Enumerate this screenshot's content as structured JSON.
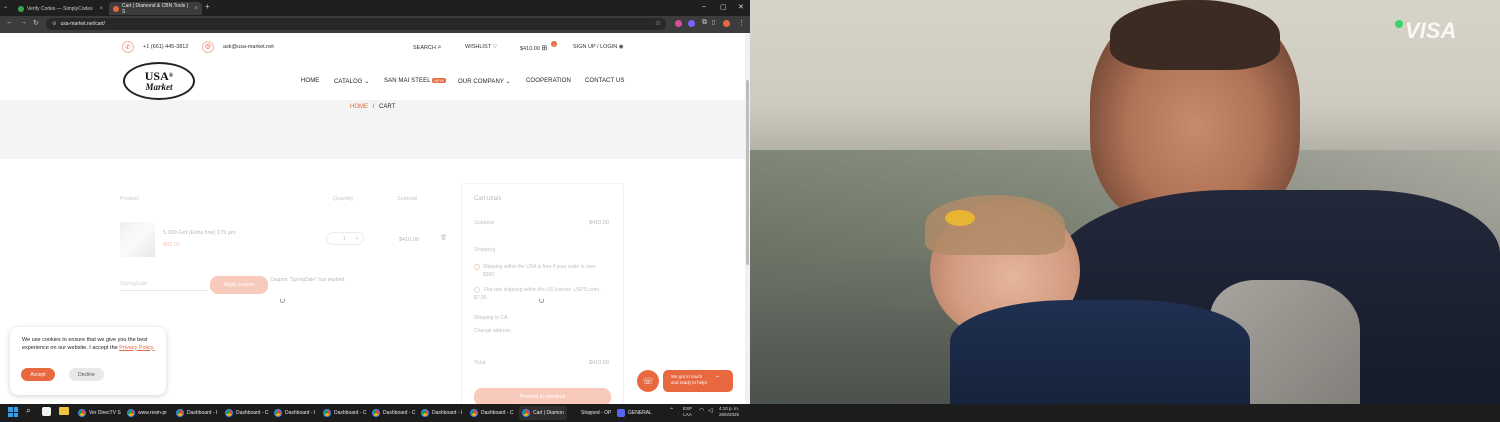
{
  "browser": {
    "tabs": [
      {
        "title": "Verify Codes — SimplyCodes",
        "active": false,
        "color": "#34a853"
      },
      {
        "title": "Cart | Diamond & CBN Tools | S",
        "active": true,
        "color": "#e8683f"
      }
    ],
    "new_tab": "+",
    "url": "usa-market.net/cart/",
    "window_controls": {
      "minimize": "–",
      "maximize": "▢",
      "close": "✕"
    }
  },
  "site": {
    "phone": "+1 (661) 445-3812",
    "email": "ask@usa-market.net",
    "search_label": "SEARCH",
    "wishlist_label": "WISHLIST",
    "cart_total": "$410.00",
    "cart_count": "1",
    "sign_label": "SIGN UP / LOGIN",
    "logo": {
      "top": "USA",
      "reg": "®",
      "bottom": "Market"
    },
    "nav": [
      {
        "label": "HOME"
      },
      {
        "label": "CATALOG",
        "chevron": "⌄"
      },
      {
        "label": "SAN MAI STEEL",
        "badge": "NEW"
      },
      {
        "label": "OUR COMPANY",
        "chevron": "⌄"
      },
      {
        "label": "COOPERATION"
      },
      {
        "label": "CONTACT US"
      }
    ],
    "accent": "#e8683f"
  },
  "breadcrumb": {
    "home": "HOME",
    "sep": "/",
    "current": "CART"
  },
  "cart": {
    "headers": {
      "product": "Product",
      "quantity": "Quantity",
      "subtotal": "Subtotal"
    },
    "item": {
      "name": "5,000 Grit (Extra fine) 175 µm",
      "price": "$82.00",
      "qty": "1",
      "subtotal": "$410.00",
      "minus": "-",
      "plus": "+",
      "remove": "🗑"
    },
    "coupon": {
      "placeholder": "SpringSale",
      "button": "Apply coupon",
      "message": "Coupon \"SpringSale\" has expired."
    }
  },
  "totals": {
    "title": "Cart totals",
    "subtotal_label": "Subtotal",
    "subtotal_value": "$410.00",
    "shipping_label": "Shipping",
    "option1": "Shipping within the USA is free if your order is over $300",
    "option2": "Flat rate shipping within the US (carrier: USPS.com): $7.00",
    "shipping_to": "Shipping to CA.",
    "change_address": "Change address",
    "total_label": "Total",
    "total_value": "$410.00",
    "checkout": "Proceed to checkout"
  },
  "cookie": {
    "text": "We use cookies to ensure that we give you the best experience on our website. I accept the",
    "link": "Privacy Policy.",
    "accept": "Accept",
    "decline": "Decline"
  },
  "chat": {
    "line1": "We got in touch",
    "line2": "and ready to help!"
  },
  "video": {
    "brand": "VISA"
  },
  "taskbar": {
    "items": [
      "Ver DirecTV S",
      "www.resin-pr",
      "Dashboard - I",
      "Dashboard - C",
      "Dashboard - I",
      "Dashboard - C",
      "Dashboard - C",
      "Dashboard - I",
      "Dashboard - C",
      "Cart | Diamon",
      "Stopped - OP",
      "GENERAL"
    ],
    "lang_top": "ESP",
    "lang_bottom": "LAA",
    "time": "4:10 p. m.",
    "date": "25/6/2025"
  }
}
